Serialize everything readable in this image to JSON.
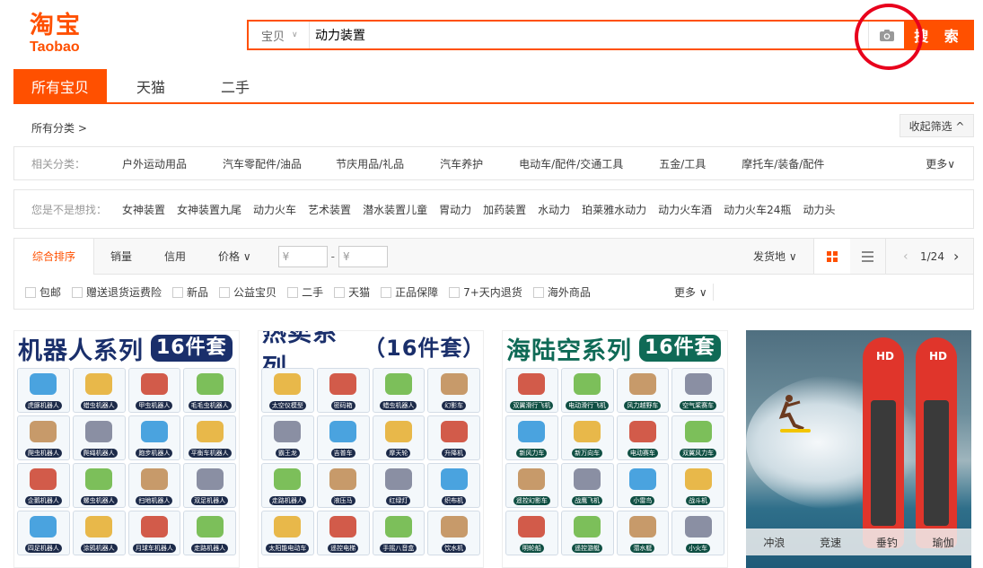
{
  "logo": {
    "cn": "淘宝",
    "en": "Taobao"
  },
  "search": {
    "category": "宝贝",
    "query": "动力装置",
    "button": "搜 索"
  },
  "tabs": [
    "所有宝贝",
    "天猫",
    "二手"
  ],
  "crumb": {
    "all": "所有分类 >",
    "collapse": "收起筛选 ^"
  },
  "related": {
    "label": "相关分类：",
    "items": [
      "户外运动用品",
      "汽车零配件/油品",
      "节庆用品/礼品",
      "汽车养护",
      "电动车/配件/交通工具",
      "五金/工具",
      "摩托车/装备/配件"
    ],
    "more": "更多"
  },
  "suggest": {
    "label": "您是不是想找：",
    "items": [
      "女神装置",
      "女神装置九尾",
      "动力火车",
      "艺术装置",
      "潜水装置儿童",
      "胃动力",
      "加药装置",
      "水动力",
      "珀莱雅水动力",
      "动力火车酒",
      "动力火车24瓶",
      "动力头"
    ]
  },
  "sort": {
    "items": [
      "综合排序",
      "销量",
      "信用",
      "价格"
    ],
    "price_from": "¥",
    "price_to": "¥",
    "price_sep": "-",
    "ship": "发货地",
    "page": "1/24"
  },
  "filters": {
    "items": [
      "包邮",
      "赠送退货运费险",
      "新品",
      "公益宝贝",
      "二手",
      "天猫",
      "正品保障",
      "7+天内退货",
      "海外商品"
    ],
    "more": "更多"
  },
  "products": [
    {
      "title": "机器人系列",
      "badge": "16件套",
      "color": "#1a2f6b",
      "badge_color": "#1a2f6b",
      "cells": [
        "虎豚机器人",
        "蜡虫机器人",
        "甲虫机器人",
        "毛毛虫机器人",
        "爬虫机器人",
        "爬绳机器人",
        "跑步机器人",
        "平衡车机器人",
        "企鹅机器人",
        "螺虫机器人",
        "扫地机器人",
        "双足机器人",
        "四足机器人",
        "涂鸦机器人",
        "月球车机器人",
        "走路机器人"
      ]
    },
    {
      "title": "热卖系列",
      "badge": "（16件套）",
      "color": "#1a2f6b",
      "badge_color": "",
      "cells": [
        "太空仪模型",
        "密码箱",
        "蜡虫机器人",
        "幻影车",
        "霸王龙",
        "吉普车",
        "摩天轮",
        "升降机",
        "走路机器人",
        "液压马",
        "红绿灯",
        "织布机",
        "太阳能电动车",
        "遥控电梯",
        "手摇八音盒",
        "饮水机"
      ]
    },
    {
      "title": "海陆空系列",
      "badge": "16件套",
      "color": "#0f6a56",
      "badge_color": "#0f6a56",
      "cells": [
        "双翼滑行飞机",
        "电动滑行飞机",
        "风力越野车",
        "空气桨赛车",
        "新风力车",
        "新万向车",
        "电动赛车",
        "双翼风力车",
        "遥控幻影车",
        "战鹰飞机",
        "小雷鸟",
        "战斗机",
        "明轮船",
        "遥控游艇",
        "潜水艇",
        "小火车"
      ]
    }
  ],
  "sup": {
    "logo": "HD",
    "caps": [
      "冲浪",
      "竞速",
      "垂钓",
      "瑜伽"
    ]
  }
}
